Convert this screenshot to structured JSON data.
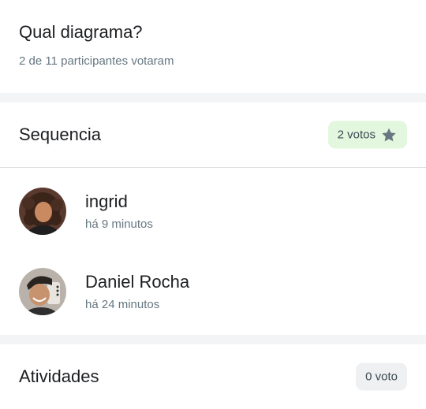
{
  "poll": {
    "title": "Qual diagrama?",
    "subtitle": "2 de 11 participantes votaram"
  },
  "options": [
    {
      "name": "Sequencia",
      "votes_label": "2 votos",
      "has_star": true,
      "voters": [
        {
          "name": "ingrid",
          "time": "há 9 minutos"
        },
        {
          "name": "Daniel Rocha",
          "time": "há 24 minutos"
        }
      ]
    },
    {
      "name": "Atividades",
      "votes_label": "0 voto",
      "has_star": false
    }
  ],
  "icons": {
    "star": "star-icon"
  },
  "colors": {
    "badge_winner_bg": "#e2f7de",
    "badge_default_bg": "#eef0f2",
    "secondary_text": "#667781",
    "star": "#667781"
  }
}
